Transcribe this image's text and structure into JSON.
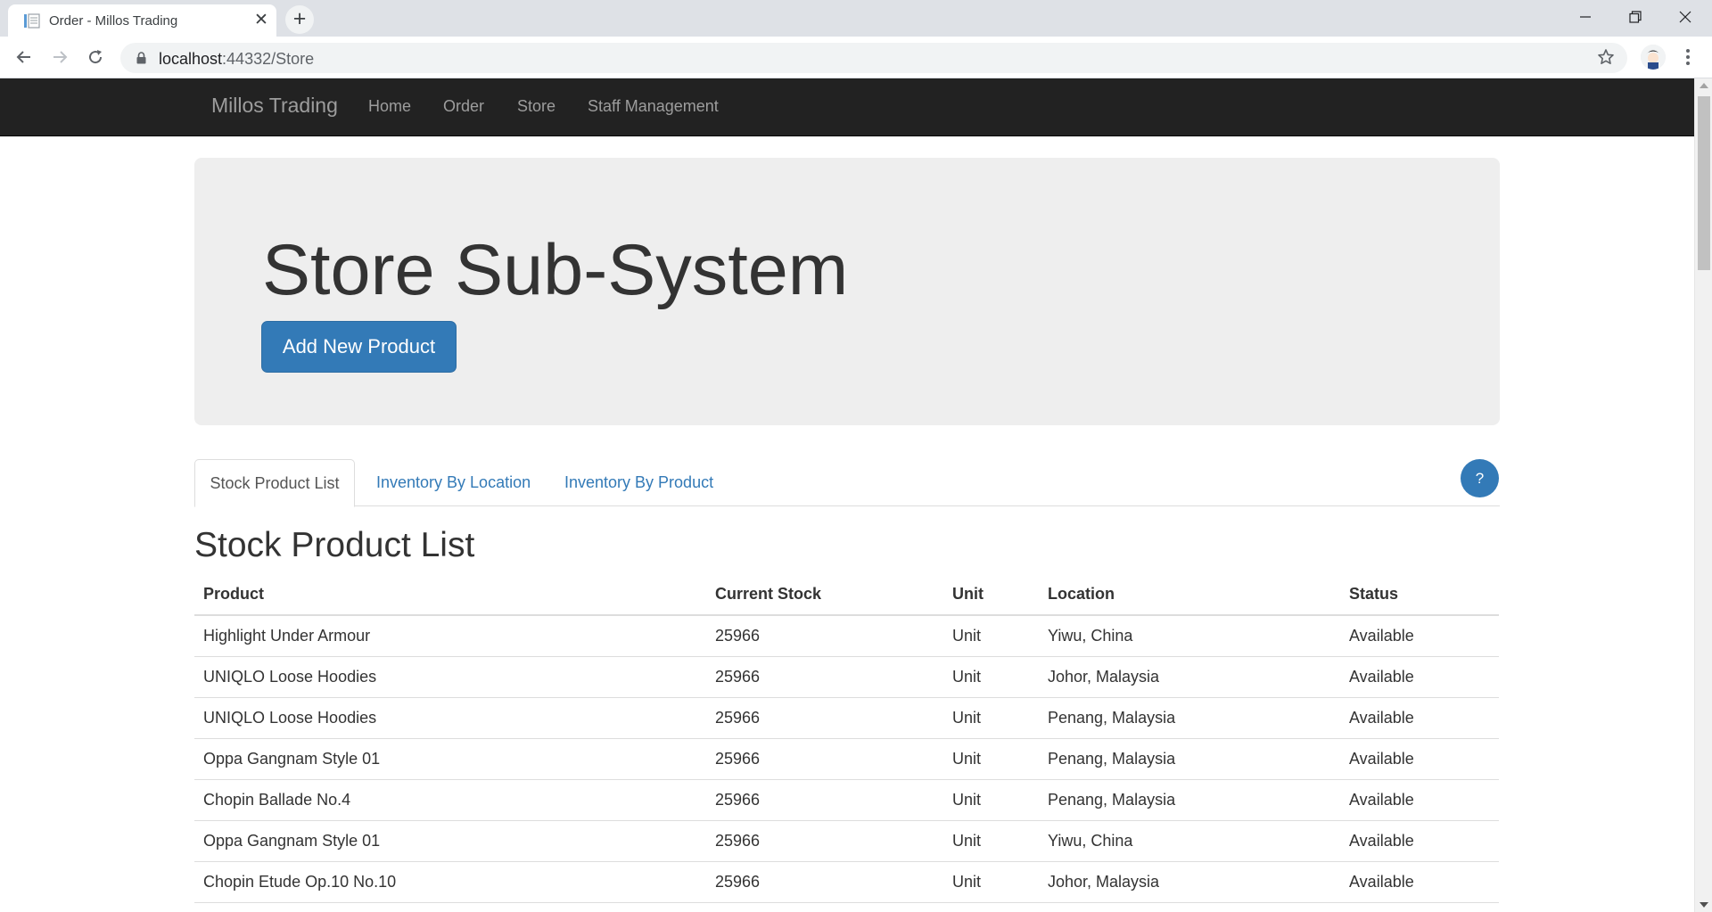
{
  "browser": {
    "tab_title": "Order - Millos Trading",
    "url_host": "localhost",
    "url_path": ":44332/Store"
  },
  "navbar": {
    "brand": "Millos Trading",
    "links": [
      "Home",
      "Order",
      "Store",
      "Staff Management"
    ]
  },
  "jumbotron": {
    "title": "Store Sub-System",
    "add_button": "Add New Product"
  },
  "tabs": [
    "Stock Product List",
    "Inventory By Location",
    "Inventory By Product"
  ],
  "help_button": "?",
  "section_title": "Stock Product List",
  "table": {
    "headers": [
      "Product",
      "Current Stock",
      "Unit",
      "Location",
      "Status"
    ],
    "rows": [
      [
        "Highlight Under Armour",
        "25966",
        "Unit",
        "Yiwu, China",
        "Available"
      ],
      [
        "UNIQLO Loose Hoodies",
        "25966",
        "Unit",
        "Johor, Malaysia",
        "Available"
      ],
      [
        "UNIQLO Loose Hoodies",
        "25966",
        "Unit",
        "Penang, Malaysia",
        "Available"
      ],
      [
        "Oppa Gangnam Style 01",
        "25966",
        "Unit",
        "Penang, Malaysia",
        "Available"
      ],
      [
        "Chopin Ballade No.4",
        "25966",
        "Unit",
        "Penang, Malaysia",
        "Available"
      ],
      [
        "Oppa Gangnam Style 01",
        "25966",
        "Unit",
        "Yiwu, China",
        "Available"
      ],
      [
        "Chopin Etude Op.10 No.10",
        "25966",
        "Unit",
        "Johor, Malaysia",
        "Available"
      ]
    ]
  },
  "colors": {
    "primary": "#337ab7",
    "navbar_bg": "#222222",
    "jumbotron_bg": "#eeeeee"
  },
  "icons": {
    "back": "arrow-left-icon",
    "forward": "arrow-right-icon",
    "reload": "reload-icon",
    "lock": "lock-icon",
    "bookmark": "star-icon",
    "menu": "kebab-menu-icon"
  }
}
